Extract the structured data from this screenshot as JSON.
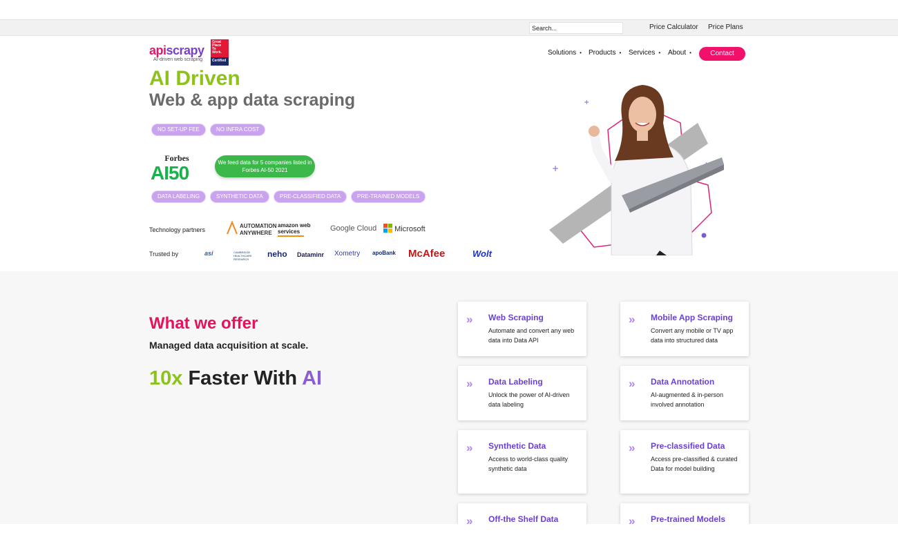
{
  "topbar": {
    "search_placeholder": "Search...",
    "links": [
      "Price Calculator",
      "Price Plans"
    ]
  },
  "logo": {
    "part1": "api",
    "part2": "scrapy",
    "tagline": "AI-driven web scraping",
    "badge_lines": [
      "Great",
      "Place",
      "To",
      "Work."
    ],
    "badge_cert": "Certified"
  },
  "nav": {
    "items": [
      "Solutions",
      "Products",
      "Services",
      "About"
    ],
    "contact": "Contact"
  },
  "hero": {
    "title_line1": "AI Driven",
    "title_line2": "Web & app data scraping",
    "pills_top": [
      "NO SET-UP FEE",
      "NO INFRA COST"
    ],
    "forbes_word": "Forbes",
    "forbes_ai50": "AI50",
    "feed_badge": "We feed data for 5 companies listed in Forbes AI-50 2021",
    "pills_mid": [
      "DATA LABELING",
      "SYNTHETIC DATA",
      "PRE-CLASSIFIED DATA",
      "PRE-TRAINED MODELS"
    ],
    "tech_label": "Technology partners",
    "tech_partners": [
      "AUTOMATION ANYWHERE",
      "amazon web services",
      "Google Cloud",
      "Microsoft"
    ],
    "trusted_label": "Trusted by",
    "trusted_logos": [
      "asi",
      "CAMBRIDGE HEALTHCARE RESEARCH",
      "neho",
      "Dataminr",
      "Xometry",
      "apoBank",
      "McAfee",
      "Wolt"
    ]
  },
  "offer": {
    "title": "What we offer",
    "subtitle": "Managed data acquisition at scale.",
    "faster_num": "10x",
    "faster_mid": " Faster With ",
    "faster_ai": "AI",
    "chevron": "»",
    "cards": [
      {
        "title": "Web Scraping",
        "desc": "Automate and convert any web data into Data API"
      },
      {
        "title": "Mobile App Scraping",
        "desc": "Convert any mobile or TV app data into structured data"
      },
      {
        "title": "Data Labeling",
        "desc": "Unlock the power of AI-driven data labeling"
      },
      {
        "title": "Data Annotation",
        "desc": "AI-augmented & in-person involved annotation"
      },
      {
        "title": "Synthetic Data",
        "desc": "Access to world-class quality synthetic data"
      },
      {
        "title": "Pre-classified Data",
        "desc": "Access pre-classified & curated Data for model building"
      },
      {
        "title": "Off-the Shelf Data",
        "desc": ""
      },
      {
        "title": "Pre-trained Models",
        "desc": ""
      }
    ]
  },
  "colors": {
    "accent_pink": "#f1106a",
    "accent_green": "#8cc21a",
    "accent_purple": "#6a3fd6",
    "pill_purple": "#c9a3ee"
  }
}
